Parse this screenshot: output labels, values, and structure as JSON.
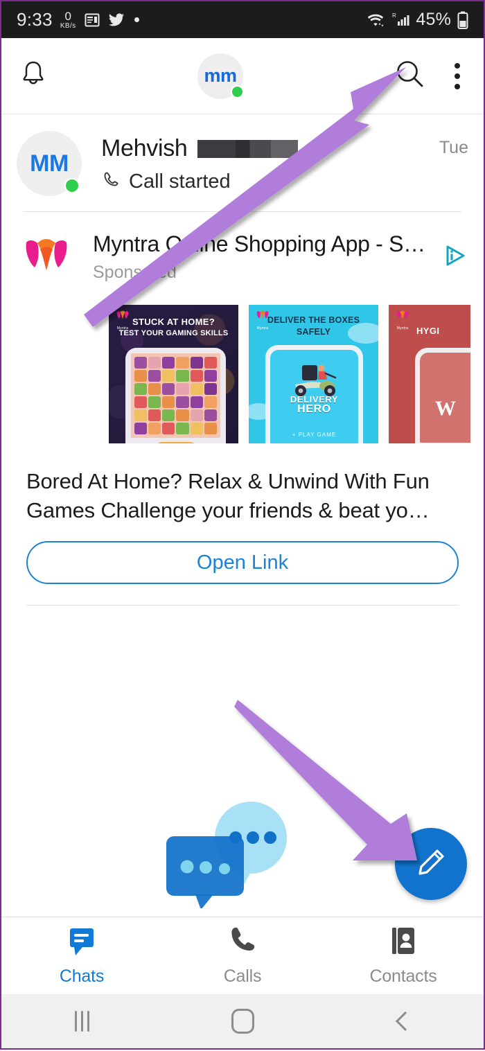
{
  "status_bar": {
    "time": "9:33",
    "net_speed_value": "0",
    "net_speed_unit": "KB/s",
    "icons": [
      "calendar-icon",
      "twitter-icon",
      "dot-icon"
    ],
    "right_icons": [
      "wifi-icon",
      "roaming-signal-icon"
    ],
    "battery_percent": "45%",
    "background": "#1c1c1c"
  },
  "app_header": {
    "bell_icon": "bell-icon",
    "avatar_initials": "mm",
    "avatar_presence": "online",
    "search_icon": "search-icon",
    "menu_icon": "kebab-menu-icon"
  },
  "chat_list": {
    "items": [
      {
        "avatar_initials": "MM",
        "name": "Mehvish",
        "name_redacted": true,
        "preview_icon": "phone-call-icon",
        "preview": "Call started",
        "time": "Tue",
        "presence": "online"
      }
    ]
  },
  "ad": {
    "logo": "myntra-logo",
    "title": "Myntra Online Shopping App - Sh…",
    "sponsored_label": "Sponsored",
    "adchoices_icon": "adchoices-icon",
    "cards": [
      {
        "headline_line1": "STUCK AT HOME?",
        "headline_line2": "TEST YOUR GAMING SKILLS",
        "brand": "Myntra",
        "background": "#241b3e"
      },
      {
        "headline_line1": "DELIVER THE BOXES",
        "headline_line2": "SAFELY",
        "logo_line1": "DELIVERY",
        "logo_line2": "HERO",
        "cta": "+ PLAY GAME",
        "brand": "Myntra",
        "background": "#2fc6e8"
      },
      {
        "headline_line1": "HYGI",
        "letter": "W",
        "brand": "Myntra",
        "background": "#bd4e4b"
      }
    ],
    "description": "Bored At Home? Relax & Unwind With Fun Games Challenge your friends & beat yo…",
    "button_label": "Open Link",
    "button_color": "#1a82d8"
  },
  "empty_state": {
    "illustration": "chat-bubbles-illustration"
  },
  "fab": {
    "icon": "compose-pencil-icon",
    "color": "#1173cd"
  },
  "bottom_tabs": {
    "items": [
      {
        "label": "Chats",
        "icon": "chat-bubble-icon",
        "active": true
      },
      {
        "label": "Calls",
        "icon": "phone-icon",
        "active": false
      },
      {
        "label": "Contacts",
        "icon": "contacts-book-icon",
        "active": false
      }
    ],
    "active_color": "#1179d6",
    "inactive_color": "#8b8b8b"
  },
  "android_nav": {
    "recents_icon": "recents-icon",
    "home_icon": "home-icon",
    "back_icon": "back-icon"
  },
  "annotations": {
    "color": "#b07ddb",
    "arrows": [
      {
        "name": "arrow-to-search",
        "points_to": "search-icon"
      },
      {
        "name": "arrow-to-compose-fab",
        "points_to": "compose-fab"
      }
    ]
  }
}
